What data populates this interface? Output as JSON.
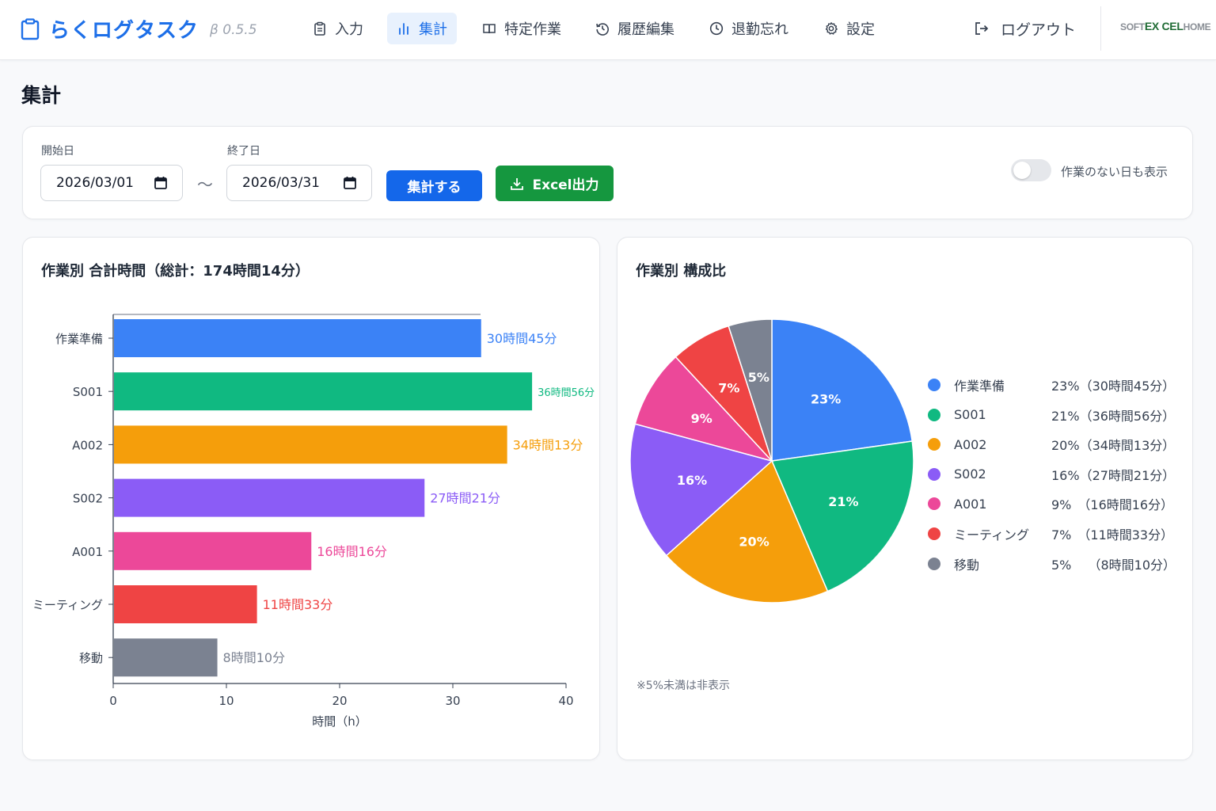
{
  "app": {
    "name": "らくログタスク",
    "version": "β 0.5.5"
  },
  "nav": [
    {
      "label": "入力",
      "icon": "clipboard-icon",
      "active": false
    },
    {
      "label": "集計",
      "icon": "bar-chart-icon",
      "active": true
    },
    {
      "label": "特定作業",
      "icon": "book-icon",
      "active": false
    },
    {
      "label": "履歴編集",
      "icon": "history-icon",
      "active": false
    },
    {
      "label": "退勤忘れ",
      "icon": "clock-icon",
      "active": false
    },
    {
      "label": "設定",
      "icon": "gear-icon",
      "active": false
    }
  ],
  "logout_label": "ログアウト",
  "logo": {
    "part1": "SOFT",
    "part2": "EX CEL",
    "part3": "HOME"
  },
  "page_title": "集計",
  "filter": {
    "start_label": "開始日",
    "start_value": "2026/03/01",
    "separator": "～",
    "end_label": "終了日",
    "end_value": "2026/03/31",
    "aggregate_button": "集計する",
    "excel_button": "Excel出力",
    "toggle_label": "作業のない日も表示",
    "toggle_on": false
  },
  "bar_card_title": "作業別 合計時間（総計：174時間14分）",
  "pie_card_title": "作業別 構成比",
  "pie_footnote": "※5%未満は非表示",
  "chart_data": [
    {
      "type": "bar",
      "orientation": "horizontal",
      "categories": [
        "作業準備",
        "S001",
        "A002",
        "S002",
        "A001",
        "ミーティング",
        "移動"
      ],
      "values": [
        32.5,
        37,
        34.8,
        27.5,
        17.5,
        12.7,
        9.2
      ],
      "data_labels": [
        "30時間45分",
        "36時間56分",
        "34時間13分",
        "27時間21分",
        "16時間16分",
        "11時間33分",
        "8時間10分"
      ],
      "colors": [
        "#3b82f6",
        "#10b981",
        "#f59e0b",
        "#8b5cf6",
        "#ec4899",
        "#ef4444",
        "#7b8291"
      ],
      "xlabel": "時間（h）",
      "xlim": [
        0,
        40
      ],
      "xticks": [
        0,
        10,
        20,
        30,
        40
      ],
      "grid": false
    },
    {
      "type": "pie",
      "categories": [
        "作業準備",
        "S001",
        "A002",
        "S002",
        "A001",
        "ミーティング",
        "移動"
      ],
      "values": [
        23,
        21,
        20,
        16,
        9,
        7,
        5
      ],
      "slice_labels": [
        "23%",
        "21%",
        "20%",
        "16%",
        "9%",
        "7%",
        "5%"
      ],
      "legend_values": [
        "23%（30時間45分）",
        "21%（36時間56分）",
        "20%（34時間13分）",
        "16%（27時間21分）",
        "9%　（16時間16分）",
        "7%　（11時間33分）",
        "5%　 （8時間10分）"
      ],
      "colors": [
        "#3b82f6",
        "#10b981",
        "#f59e0b",
        "#8b5cf6",
        "#ec4899",
        "#ef4444",
        "#7b8291"
      ],
      "legend_position": "right"
    }
  ]
}
